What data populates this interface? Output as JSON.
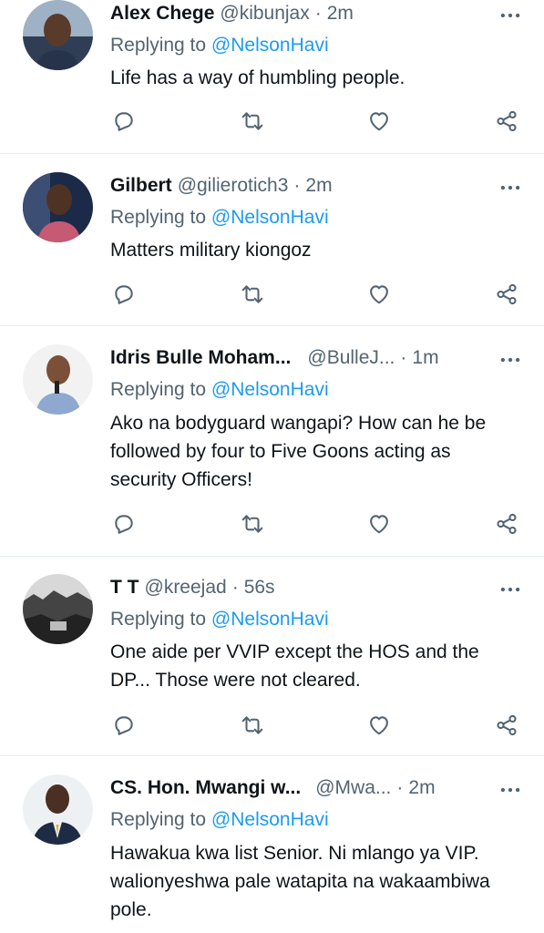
{
  "tweets": [
    {
      "name": "Alex Chege",
      "handle": "@kibunjax",
      "time": "2m",
      "replying_prefix": "Replying to",
      "mention": "@NelsonHavi",
      "text": "Life has a way of humbling people."
    },
    {
      "name": "Gilbert",
      "handle": "@gilierotich3",
      "time": "2m",
      "replying_prefix": "Replying to",
      "mention": "@NelsonHavi",
      "text": "Matters military kiongoz"
    },
    {
      "name": "Idris Bulle Moham...",
      "handle": "@BulleJ...",
      "time": "1m",
      "replying_prefix": "Replying to",
      "mention": "@NelsonHavi",
      "text": "Ako na bodyguard wangapi? How can he be followed by  four to Five Goons acting as security Officers!"
    },
    {
      "name": "T T",
      "handle": "@kreejad",
      "time": "56s",
      "replying_prefix": "Replying to",
      "mention": "@NelsonHavi",
      "text": "One aide per VVIP except the HOS and the DP... Those were not cleared."
    },
    {
      "name": "CS. Hon. Mwangi w...",
      "handle": "@Mwa...",
      "time": "2m",
      "replying_prefix": "Replying to",
      "mention": "@NelsonHavi",
      "text": "Hawakua kwa list Senior. Ni mlango ya VIP. walionyeshwa pale watapita na wakaambiwa pole."
    }
  ],
  "separator": "·",
  "colors": {
    "text": "#0f1419",
    "secondary": "#536471",
    "link": "#1d9bf0",
    "divider": "#e6ecf0"
  },
  "icons": [
    "reply-icon",
    "retweet-icon",
    "like-icon",
    "share-icon",
    "more-icon"
  ]
}
